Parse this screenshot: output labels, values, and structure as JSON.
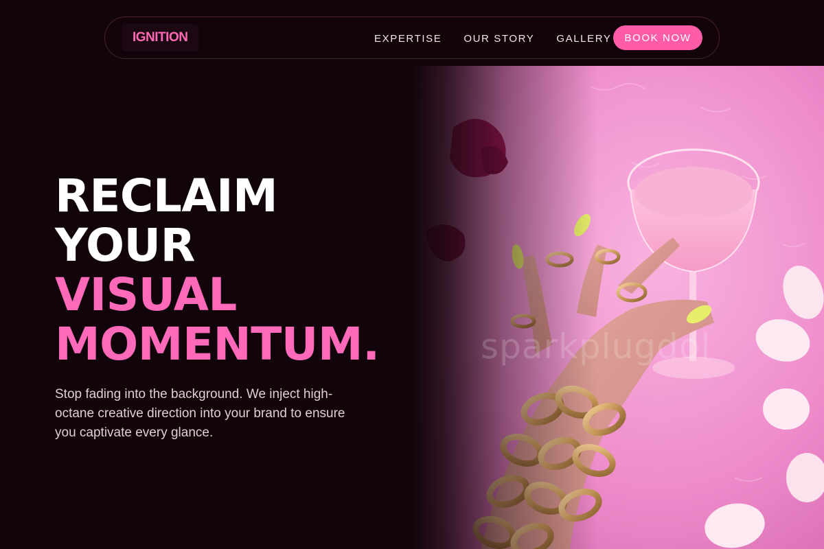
{
  "nav": {
    "logo": "IGNITION",
    "links": [
      "EXPERTISE",
      "OUR STORY",
      "GALLERY"
    ],
    "cta": "BOOK NOW"
  },
  "hero": {
    "title_lines": [
      "RECLAIM",
      "YOUR",
      "VISUAL",
      "MOMENTUM."
    ],
    "subtitle": "Stop fading into the background. We inject high-octane creative direction into your brand to ensure you captivate every glance."
  },
  "photo": {
    "watermark": "sparkplugdol"
  },
  "colors": {
    "background": "#12040b",
    "accent": "#ff69b9",
    "button": "#ff5ca8",
    "nav_border": "#4a2232"
  }
}
